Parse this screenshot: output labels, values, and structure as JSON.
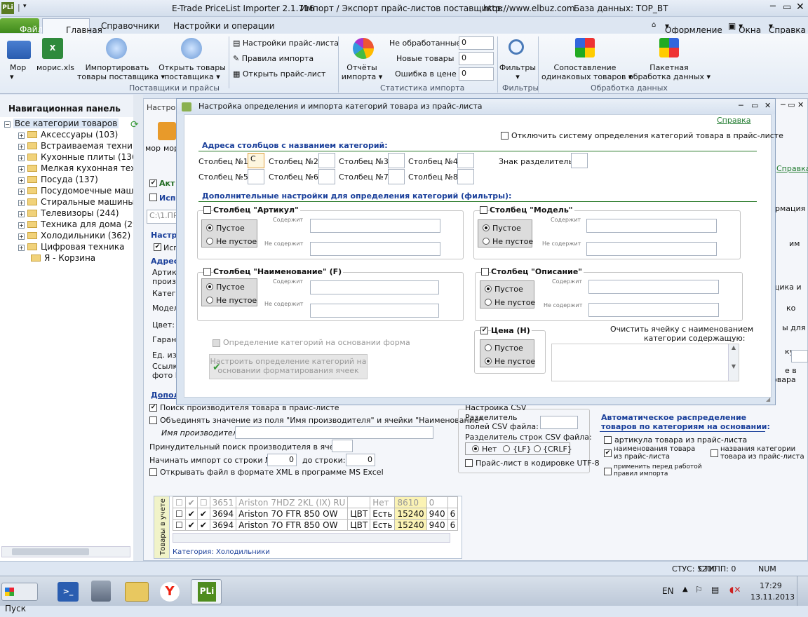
{
  "window": {
    "title": "E-Trade PriceList Importer 2.1.716",
    "subtitle": "Импорт / Экспорт прайс-листов поставщиков",
    "url": "http://www.elbuz.com",
    "db": "База данных: TOP_BT",
    "logo": "PLi"
  },
  "menu": {
    "file": "Файл",
    "tabs": [
      "Главная",
      "Справочники",
      "Настройки и операции"
    ],
    "right": [
      "Оформление",
      "Окна",
      "Справка"
    ]
  },
  "ribbon": {
    "mor": "Мор",
    "moris": "морис.xls",
    "import1": "Импортировать",
    "import2": "товары поставщика",
    "open1": "Открыть товары",
    "open2": "поставщика",
    "settings_pl": "Настройки прайс-листа",
    "import_rules": "Правила импорта",
    "open_pl": "Открыть прайс-лист",
    "group_suppliers": "Поставщики и прайсы",
    "reports1": "Отчёты",
    "reports2": "импорта",
    "stat_labels": [
      "Не обработанные",
      "Новые товары",
      "Ошибка в цене"
    ],
    "stat_values": [
      "0",
      "0",
      "0"
    ],
    "group_stats": "Статистика импорта",
    "filters": "Фильтры",
    "group_filters": "Фильтры",
    "compare1": "Сопоставление",
    "compare2": "одинаковых товаров",
    "batch1": "Пакетная",
    "batch2": "обработка данных",
    "group_data": "Обработка данных"
  },
  "nav": {
    "title": "Навигационная панель",
    "root": "Все категории товаров",
    "items": [
      "Аксессуары (103)",
      "Встраиваемая техник",
      "Кухонные плиты (136",
      "Мелкая кухонная техн",
      "Посуда (137)",
      "Посудомоечные маши",
      "Стиральные машины (",
      "Телевизоры (244)",
      "Техника для дома (29",
      "Холодильники (362)",
      "Цифровая техника",
      "Я - Корзина"
    ]
  },
  "back": {
    "title": "Настрой",
    "mor": "мор",
    "mor2": "мор",
    "help": "Справка",
    "akt": "Акт",
    "isp": "Испо",
    "path": "C:\\1.ПР",
    "nastr": "Настр",
    "isp2": "Исп",
    "adres": "Адрес",
    "left_labels": [
      "Артику",
      "произ-",
      "Катего",
      "Модел",
      "Цвет:",
      "Гарант",
      "Ед. изм",
      "Ссылк",
      "фото N"
    ],
    "dopol": "Допол",
    "right_labels": [
      "рмация",
      "им",
      "щика и",
      "ко",
      "ы для",
      "кул,",
      "е в",
      "оварa"
    ],
    "search_mfr": "Поиск производителя товара в прайс-листе",
    "combine": "Объединять значение из поля \"Имя производителя\" и ячейки \"Наименование\"",
    "mfr_name": "Имя производителя:",
    "force_search": "Принудительный поиск производителя в ячейке:",
    "start_row": "Начинать импорт со строки №:",
    "start_val": "0",
    "to_row": "до строки:",
    "to_val": "0",
    "open_xml": "Открывать файл в формате XML в программе MS Excel",
    "csv_title": "Настройка CSV",
    "csv_field_sep1": "Разделитель",
    "csv_field_sep2": "полей CSV файла:",
    "csv_row_sep": "Разделитель строк CSV файла:",
    "csv_opts": [
      "Нет",
      "{LF}",
      "{CRLF}"
    ],
    "utf8": "Прайс-лист в кодировке UTF-8",
    "auto_title1": "Автоматическое распределение",
    "auto_title2": "товаров по категориям на основании:",
    "auto_opts": [
      "артикула товара из прайс-листа",
      "наименования товара из прайс-листа",
      "названия  категории товара из прайс-листа",
      "применить перед работой правил импорта"
    ],
    "grid_side": "Товары в учетe",
    "grid_rows": [
      [
        "3651",
        "Ariston 7HDZ 2KL (IX) RU",
        "",
        "Нет",
        "8610",
        "0",
        ""
      ],
      [
        "3694",
        "Ariston 7O FTR 850 OW",
        "ЦВТ",
        "Есть",
        "15240",
        "940",
        "6"
      ],
      [
        "3694",
        "Ariston 7O FTR 850 OW",
        "ЦВТ",
        "Есть",
        "15240",
        "940",
        "6"
      ]
    ],
    "grid_category": "Категория: Холодильники"
  },
  "dialog": {
    "title": "Настройка определения и импорта категорий товара из прайс-листа",
    "help": "Справка",
    "disable": "Отключить систему определения категорий товара в прайс-листе",
    "sec1": "Адреса столбцов с названием категорий:",
    "cols": [
      "Столбец №1:",
      "Столбец №2:",
      "Столбец №3:",
      "Столбец №4:",
      "Столбец №5:",
      "Столбец №6:",
      "Столбец №7:",
      "Столбец №8:"
    ],
    "col1_val": "C",
    "separator": "Знак разделитель:",
    "sec2": "Дополнительные настройки для определения категорий (фильтры):",
    "empty": "Пустое",
    "notempty": "Не пустое",
    "contains": "Содержит",
    "notcontains": "Не содержит",
    "g_article": "Столбец \"Артикул\"",
    "g_model": "Столбец \"Модель\"",
    "g_name": "Столбец \"Наименование\" (F)",
    "g_desc": "Столбец \"Описание\"",
    "g_price": "Цена (H)",
    "format_cb": "Определение категорий на основании форма",
    "format_btn1": "Настроить определение категорий на",
    "format_btn2": "основании форматирования ячеек",
    "clear1": "Очистить ячейку с наименованием",
    "clear2": "категории содержащую:"
  },
  "status": {
    "stus": "СТУС: 5200",
    "stipp": "СТИПП: 0",
    "num": "NUM"
  },
  "taskbar": {
    "start": "Пуск",
    "lang": "EN",
    "time": "17:29",
    "date": "13.11.2013"
  }
}
